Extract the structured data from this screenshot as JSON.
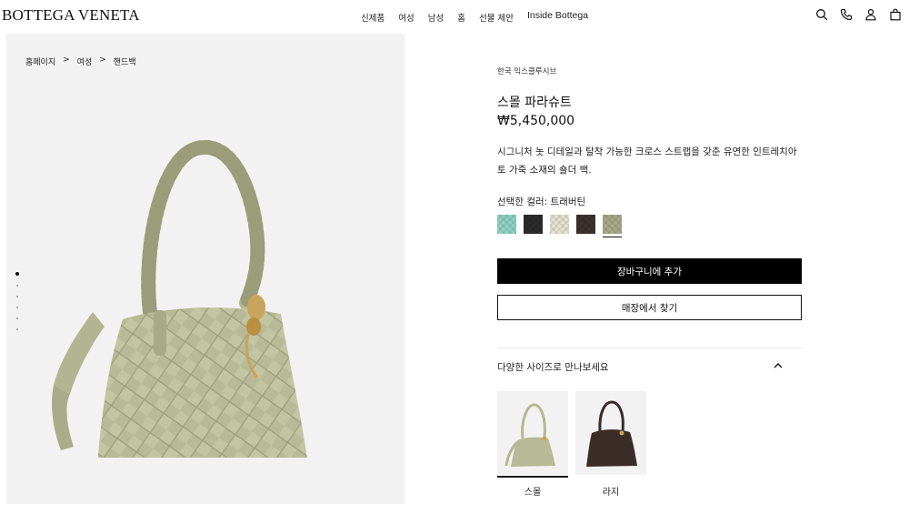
{
  "header": {
    "brand": "BOTTEGA VENETA",
    "nav": [
      "신제품",
      "여성",
      "남성",
      "홈",
      "선물 제안",
      "Inside Bottega"
    ],
    "icons": [
      "search-icon",
      "phone-icon",
      "account-icon",
      "shopping-bag-icon"
    ]
  },
  "breadcrumb": [
    "홈페이지",
    ">",
    "여성",
    ">",
    "핸드백"
  ],
  "product": {
    "eyebrow": "한국 익스클루시브",
    "title": "스몰 파라슈트",
    "price": "₩5,450,000",
    "description": "시그니처 놋 디테일과 탈착 가능한 크로스 스트랩을 갖춘 유연한 인트레치아토 가죽 소재의 숄더 백.",
    "selected_color_label": "선택한 컬러: 트래버틴",
    "swatches": [
      {
        "color": "#8fd3c6",
        "selected": false
      },
      {
        "color": "#2c2c2c",
        "selected": false
      },
      {
        "color": "#e8e2d4",
        "selected": false
      },
      {
        "color": "#3e322e",
        "selected": false
      },
      {
        "color": "#a8ab8a",
        "selected": true
      }
    ]
  },
  "actions": {
    "add_to_cart": "장바구니에 추가",
    "find_store": "매장에서 찾기"
  },
  "sizes_section": {
    "title": "다양한 사이즈로 만나보세요",
    "options": [
      {
        "label": "스몰",
        "selected": true
      },
      {
        "label": "라지",
        "selected": false
      }
    ]
  },
  "gallery": {
    "slide_count": 6,
    "active_slide": 1
  }
}
